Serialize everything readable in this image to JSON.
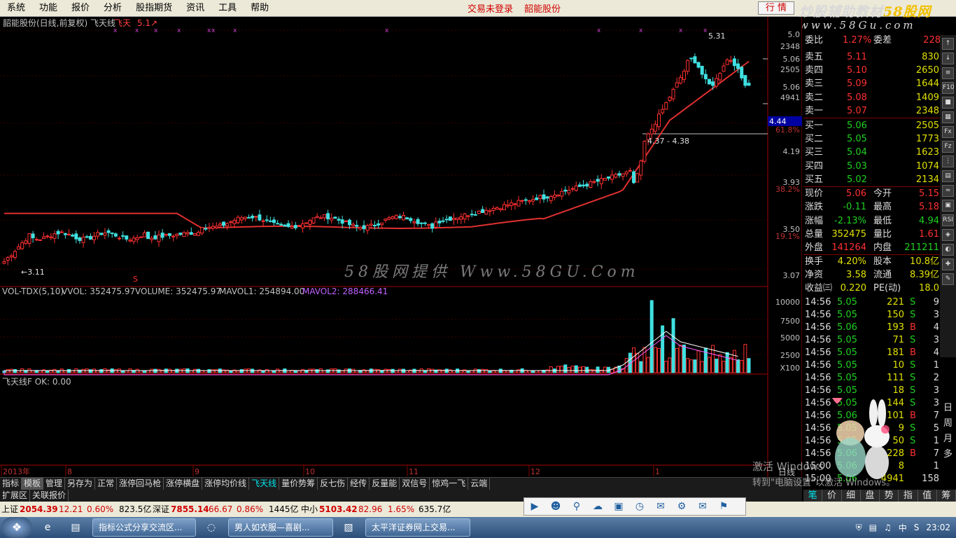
{
  "menu": {
    "items": [
      "系统",
      "功能",
      "报价",
      "分析",
      "股指期货",
      "资讯",
      "工具",
      "帮助"
    ],
    "center1": "交易未登录",
    "center2": "韶能股份",
    "quote_btn": "行 情"
  },
  "brand": {
    "line1a": "炒股辅助教材",
    "line1b": "58股网",
    "line2": "www.58Gu.com"
  },
  "chart": {
    "title": "韶能股份(日线,前复权) 飞天线",
    "indicator_tag": "飞天",
    "indicator_val": "5.1↗",
    "watermark": "58股网提供 Www.58GU.Com",
    "hilo_label": "5.31",
    "lo_label": "←3.11",
    "range_label": "4.37 - 4.38",
    "s_mark": "S",
    "cursor_price": "4.44",
    "axis_right": [
      "5.0",
      "2348",
      "5.06",
      "2505",
      "5.06",
      "4941",
      "61.8%",
      "4.19",
      "3.93",
      "38.2%",
      "3.50",
      "19.1%",
      "3.07"
    ],
    "vol_header": {
      "a": "VOL-TDX(5,10)",
      "b": "VVOL: 352475.97",
      "c": "VOLUME: 352475.97",
      "d": "MAVOL1: 254894.00",
      "e": "MAVOL2: 288466.41"
    },
    "vol_axis": [
      "10000",
      "7500",
      "5000",
      "2500",
      "X100"
    ],
    "lower_header": "飞天线F OK: 0.00",
    "date_labels": [
      "2013年",
      "8",
      "9",
      "10",
      "11",
      "12",
      "1"
    ],
    "rightaxis_label": "日线"
  },
  "chart_data": {
    "type": "candlestick",
    "price_ylim": [
      3.07,
      5.31
    ],
    "highs": {
      "max": 5.31,
      "min": 3.11
    },
    "fib": [
      {
        "level": "61.8%",
        "price": 4.4
      },
      {
        "level": "38.2%",
        "price": 3.93
      },
      {
        "level": "19.1%",
        "price": 3.5
      }
    ],
    "volume_ylim": [
      0,
      10000
    ],
    "volume_ma": [
      {
        "name": "MAVOL1",
        "value": 254894.0
      },
      {
        "name": "MAVOL2",
        "value": 288466.41
      }
    ]
  },
  "quote": {
    "top": {
      "label": "委比",
      "pct": "1.27%",
      "diff_label": "委差",
      "diff": "228"
    },
    "sells": [
      {
        "l": "卖五",
        "p": "5.11",
        "v": "830"
      },
      {
        "l": "卖四",
        "p": "5.10",
        "v": "2650"
      },
      {
        "l": "卖三",
        "p": "5.09",
        "v": "1644"
      },
      {
        "l": "卖二",
        "p": "5.08",
        "v": "1409"
      },
      {
        "l": "卖一",
        "p": "5.07",
        "v": "2348"
      }
    ],
    "buys": [
      {
        "l": "买一",
        "p": "5.06",
        "v": "2505"
      },
      {
        "l": "买二",
        "p": "5.05",
        "v": "1773"
      },
      {
        "l": "买三",
        "p": "5.04",
        "v": "1623"
      },
      {
        "l": "买四",
        "p": "5.03",
        "v": "1074"
      },
      {
        "l": "买五",
        "p": "5.02",
        "v": "2134"
      }
    ],
    "stats": [
      {
        "l1": "现价",
        "v1": "5.06",
        "l2": "今开",
        "v2": "5.15",
        "c1": "#ff3030",
        "c2": "#ff3030"
      },
      {
        "l1": "涨跌",
        "v1": "-0.11",
        "l2": "最高",
        "v2": "5.18",
        "c1": "#20d020",
        "c2": "#ff3030"
      },
      {
        "l1": "涨幅",
        "v1": "-2.13%",
        "l2": "最低",
        "v2": "4.94",
        "c1": "#20d020",
        "c2": "#20d020"
      },
      {
        "l1": "总量",
        "v1": "352475",
        "l2": "量比",
        "v2": "1.61",
        "c1": "#e0e000",
        "c2": "#ff3030"
      },
      {
        "l1": "外盘",
        "v1": "141264",
        "l2": "内盘",
        "v2": "211211",
        "c1": "#ff3030",
        "c2": "#20d020"
      },
      {
        "l1": "换手",
        "v1": "4.20%",
        "l2": "股本",
        "v2": "10.8亿",
        "c1": "#e0e000",
        "c2": "#e0e000"
      },
      {
        "l1": "净资",
        "v1": "3.58",
        "l2": "流通",
        "v2": "8.39亿",
        "c1": "#e0e000",
        "c2": "#e0e000"
      },
      {
        "l1": "收益㈢",
        "v1": "0.220",
        "l2": "PE(动)",
        "v2": "18.0",
        "c1": "#e0e000",
        "c2": "#e0e000"
      }
    ]
  },
  "ticks": [
    {
      "t": "14:56",
      "p": "5.05",
      "v": "221",
      "d": "S",
      "n": "9"
    },
    {
      "t": "14:56",
      "p": "5.05",
      "v": "150",
      "d": "S",
      "n": "3"
    },
    {
      "t": "14:56",
      "p": "5.06",
      "v": "193",
      "d": "B",
      "n": "4"
    },
    {
      "t": "14:56",
      "p": "5.05",
      "v": "71",
      "d": "S",
      "n": "3"
    },
    {
      "t": "14:56",
      "p": "5.05",
      "v": "181",
      "d": "B",
      "n": "4"
    },
    {
      "t": "14:56",
      "p": "5.05",
      "v": "10",
      "d": "S",
      "n": "1"
    },
    {
      "t": "14:56",
      "p": "5.05",
      "v": "111",
      "d": "S",
      "n": "2"
    },
    {
      "t": "14:56",
      "p": "5.05",
      "v": "18",
      "d": "S",
      "n": "3"
    },
    {
      "t": "14:56",
      "p": "5.05",
      "v": "144",
      "d": "S",
      "n": "3"
    },
    {
      "t": "14:56",
      "p": "5.06",
      "v": "101",
      "d": "B",
      "n": "7"
    },
    {
      "t": "14:56",
      "p": "5.05",
      "v": "9",
      "d": "S",
      "n": "5"
    },
    {
      "t": "14:56",
      "p": "5.05",
      "v": "50",
      "d": "S",
      "n": "1"
    },
    {
      "t": "14:56",
      "p": "5.06",
      "v": "228",
      "d": "B",
      "n": "7"
    },
    {
      "t": "15:00",
      "p": "5.06",
      "v": "8",
      "d": "",
      "n": "1"
    },
    {
      "t": "15:00",
      "p": "5.06",
      "v": "4941",
      "d": "",
      "n": "158"
    }
  ],
  "side_tabs": [
    "日",
    "周",
    "月",
    "多"
  ],
  "sideicons": [
    "↑",
    "↓",
    "≡",
    "F10",
    "■",
    "▦",
    "Fx",
    "Fz",
    "⋮",
    "▤",
    "≈",
    "▣",
    "RSI",
    "◈",
    "◐",
    "✚",
    "✎"
  ],
  "tabs": [
    "指标",
    "模板",
    "管理",
    "另存为",
    "正常",
    "涨停回马枪",
    "涨停横盘",
    "涨停均价线",
    "飞天线",
    "量价势筹",
    "反七伤",
    "经传",
    "反量能",
    "双信号",
    "惊鸡一飞",
    "云端"
  ],
  "tabs2": [
    "扩展区",
    "关联报价"
  ],
  "rtabs": [
    "笔",
    "价",
    "细",
    "盘",
    "势",
    "指",
    "值",
    "筹"
  ],
  "status": {
    "sh_label": "上证",
    "sh": "2054.39",
    "sh_chg": "12.21",
    "sh_pct": "0.60%",
    "sh_amt": "823.5亿",
    "sz_label": "深证",
    "sz": "7855.14",
    "sz_chg": "66.67",
    "sz_pct": "0.86%",
    "sz_amt": "1445亿",
    "zx_label": "中小",
    "zx": "5103.42",
    "zx_chg": "82.96",
    "zx_pct": "1.65%",
    "zx_amt": "635.7亿"
  },
  "activate": {
    "a1": "激活 Windows",
    "a2": "转到\"电脑设置\"以激活 Windows。"
  },
  "taskbar": {
    "tasks": [
      "指标公式分享交流区...",
      "男人如衣服—喜剧...",
      "太平洋证券网上交易..."
    ],
    "time": "23:02",
    "ime": "中",
    "cn": "S"
  }
}
